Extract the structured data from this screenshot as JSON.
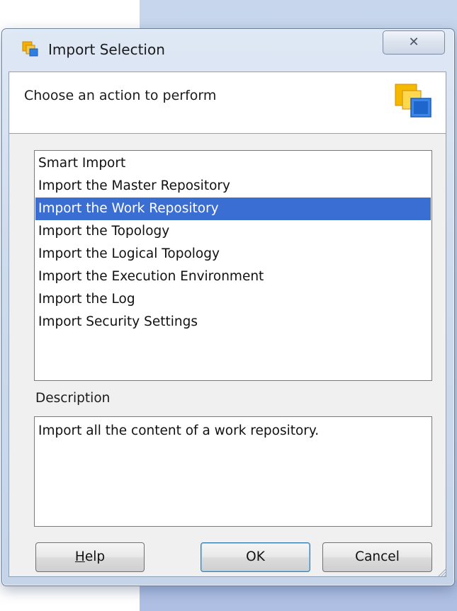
{
  "window": {
    "title": "Import Selection",
    "icon": "import-selection-icon",
    "close_icon": "close-icon"
  },
  "header": {
    "prompt": "Choose an action to perform",
    "icon": "import-selection-icon"
  },
  "actions": {
    "items": [
      {
        "label": "Smart Import",
        "selected": false
      },
      {
        "label": "Import the Master Repository",
        "selected": false
      },
      {
        "label": "Import the Work Repository",
        "selected": true
      },
      {
        "label": "Import the Topology",
        "selected": false
      },
      {
        "label": "Import the Logical Topology",
        "selected": false
      },
      {
        "label": "Import the Execution Environment",
        "selected": false
      },
      {
        "label": "Import the Log",
        "selected": false
      },
      {
        "label": "Import Security Settings",
        "selected": false
      }
    ],
    "selection_color": "#3a6ed3"
  },
  "description": {
    "label": "Description",
    "text": "Import all the content of a work repository."
  },
  "buttons": {
    "help_first": "H",
    "help_rest": "elp",
    "ok": "OK",
    "cancel": "Cancel"
  }
}
